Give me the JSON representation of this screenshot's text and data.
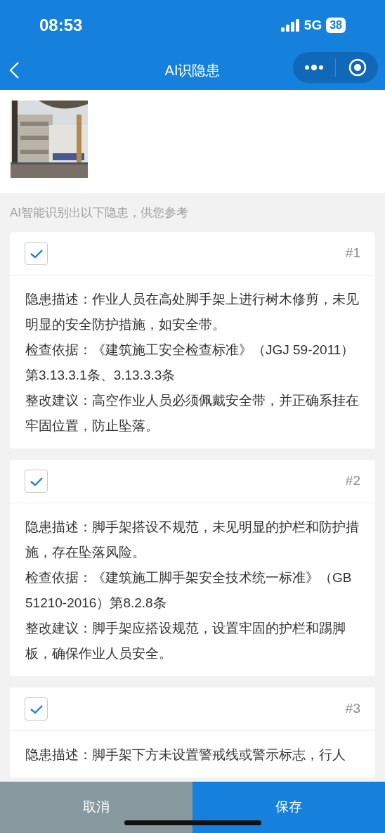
{
  "status_bar": {
    "time": "08:53",
    "network": "5G",
    "battery": "38"
  },
  "nav": {
    "title": "AI识隐患"
  },
  "hint": "AI智能识别出以下隐患，供您参考",
  "hazards": [
    {
      "number": "#1",
      "checked": true,
      "lines": [
        "隐患描述：作业人员在高处脚手架上进行树木修剪，未见明显的安全防护措施，如安全带。",
        "检查依据：《建筑施工安全检查标准》（JGJ 59-2011）第3.13.3.1条、3.13.3.3条",
        "整改建议：高空作业人员必须佩戴安全带，并正确系挂在牢固位置，防止坠落。"
      ]
    },
    {
      "number": "#2",
      "checked": true,
      "lines": [
        "隐患描述：脚手架搭设不规范，未见明显的护栏和防护措施，存在坠落风险。",
        "检查依据：《建筑施工脚手架安全技术统一标准》（GB 51210-2016）第8.2.8条",
        "整改建议：脚手架应搭设规范，设置牢固的护栏和踢脚板，确保作业人员安全。"
      ]
    },
    {
      "number": "#3",
      "checked": true,
      "lines": [
        "隐患描述：脚手架下方未设置警戒线或警示标志，行人"
      ]
    }
  ],
  "buttons": {
    "cancel": "取消",
    "save": "保存"
  }
}
